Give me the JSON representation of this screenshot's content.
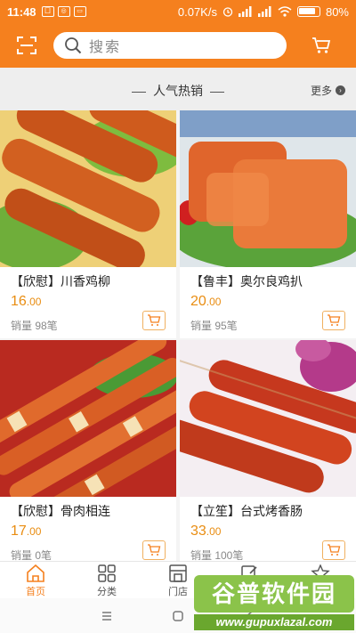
{
  "status_bar": {
    "time": "11:48",
    "network_speed": "0.07K/s",
    "battery": "80%"
  },
  "search": {
    "placeholder": "搜索"
  },
  "section": {
    "title": "人气热销",
    "more_label": "更多"
  },
  "products": [
    {
      "name": "【欣慰】川香鸡柳",
      "price_int": "16",
      "price_dec": ".00",
      "sales": "销量 98笔"
    },
    {
      "name": "【鲁丰】奥尔良鸡扒",
      "price_int": "20",
      "price_dec": ".00",
      "sales": "销量 95笔"
    },
    {
      "name": "【欣慰】骨肉相连",
      "price_int": "17",
      "price_dec": ".00",
      "sales": "销量 0笔"
    },
    {
      "name": "【立笙】台式烤香肠",
      "price_int": "33",
      "price_dec": ".00",
      "sales": "销量 100笔"
    }
  ],
  "bottom_nav": [
    {
      "label": "首页",
      "icon": "home-icon"
    },
    {
      "label": "分类",
      "icon": "grid-icon"
    },
    {
      "label": "门店",
      "icon": "store-icon"
    },
    {
      "label": "",
      "icon": "edit-icon"
    },
    {
      "label": "",
      "icon": "star-icon"
    }
  ],
  "watermark": {
    "top": "谷普软件园",
    "bottom": "www.gupuxlazal.com"
  },
  "colors": {
    "brand": "#f5801e",
    "price": "#e98d12"
  }
}
